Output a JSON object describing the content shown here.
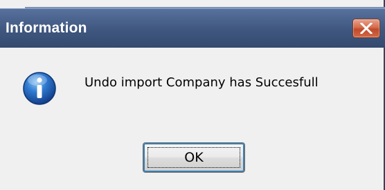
{
  "window": {
    "title": "Information",
    "close_icon": "close-icon"
  },
  "dialog": {
    "icon": "info-icon",
    "message": "Undo import Company has Succesfull",
    "ok_label": "OK"
  },
  "colors": {
    "titlebar": "#3f577f",
    "background": "#f0f0f0",
    "close_button": "#d46b4c",
    "info_icon": "#1e5fb3"
  }
}
